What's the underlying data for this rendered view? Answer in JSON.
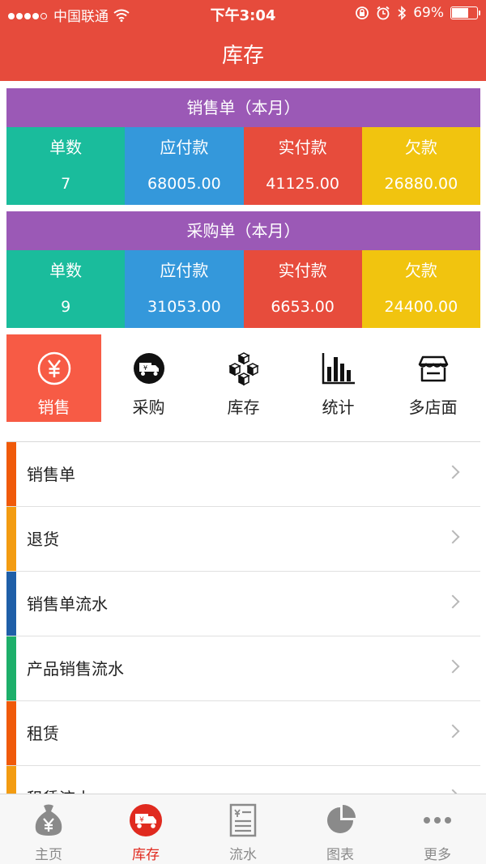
{
  "status_bar": {
    "carrier": "中国联通",
    "time": "下午3:04",
    "battery_text": "69%",
    "battery_level": 0.69
  },
  "header": {
    "title": "库存"
  },
  "sales_card": {
    "title": "销售单（本月）",
    "columns": [
      {
        "label": "单数",
        "value": "7"
      },
      {
        "label": "应付款",
        "value": "68005.00"
      },
      {
        "label": "实付款",
        "value": "41125.00"
      },
      {
        "label": "欠款",
        "value": "26880.00"
      }
    ]
  },
  "purchase_card": {
    "title": "采购单（本月）",
    "columns": [
      {
        "label": "单数",
        "value": "9"
      },
      {
        "label": "应付款",
        "value": "31053.00"
      },
      {
        "label": "实付款",
        "value": "6653.00"
      },
      {
        "label": "欠款",
        "value": "24400.00"
      }
    ]
  },
  "category_tabs": [
    {
      "label": "销售",
      "icon": "yen-circle-icon",
      "active": true
    },
    {
      "label": "采购",
      "icon": "truck-icon",
      "active": false
    },
    {
      "label": "库存",
      "icon": "boxes-icon",
      "active": false
    },
    {
      "label": "统计",
      "icon": "bar-chart-icon",
      "active": false
    },
    {
      "label": "多店面",
      "icon": "store-icon",
      "active": false
    }
  ],
  "menu_items": [
    {
      "label": "销售单",
      "color": "#F05A0A"
    },
    {
      "label": "退货",
      "color": "#F39C12"
    },
    {
      "label": "销售单流水",
      "color": "#1F5FA8"
    },
    {
      "label": "产品销售流水",
      "color": "#1DAF6A"
    },
    {
      "label": "租赁",
      "color": "#F05A0A"
    },
    {
      "label": "租赁流水",
      "color": "#F39C12"
    }
  ],
  "bottom_tabs": [
    {
      "label": "主页",
      "icon": "money-bag-icon"
    },
    {
      "label": "库存",
      "icon": "inventory-truck-icon"
    },
    {
      "label": "流水",
      "icon": "ledger-icon"
    },
    {
      "label": "图表",
      "icon": "pie-chart-icon"
    },
    {
      "label": "更多",
      "icon": "more-dots-icon"
    }
  ],
  "colors": {
    "header": "#E64B3C",
    "card_header": "#9B59B6",
    "teal": "#1ABC9C",
    "blue": "#3498DB",
    "red": "#E74C3C",
    "yellow": "#F1C40F",
    "active_tab": "#F75B45",
    "active_bottom": "#E02A1F"
  }
}
